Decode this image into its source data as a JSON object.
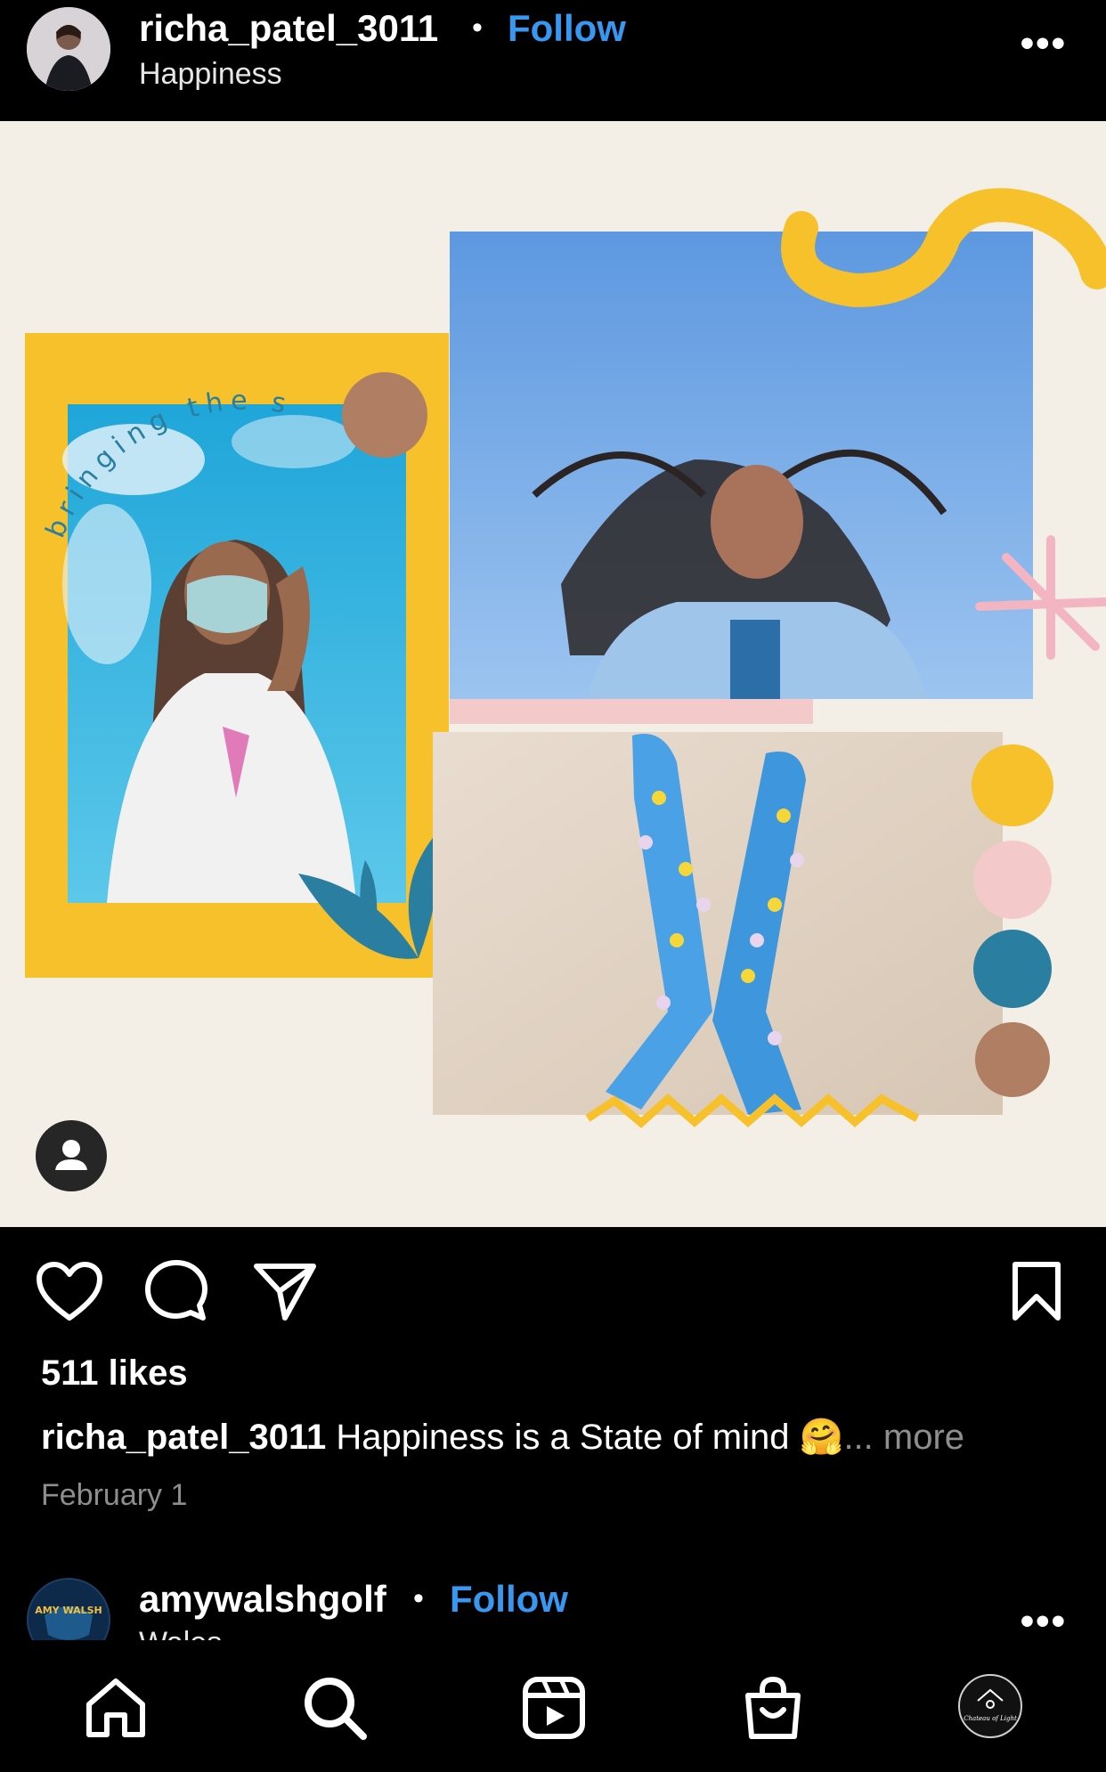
{
  "post": {
    "username": "richa_patel_3011",
    "separator": "•",
    "follow_label": "Follow",
    "subtitle": "Happiness",
    "more_label": "•••",
    "image": {
      "arc_text": "bringing the sunshine",
      "tag_people_icon": "person-icon"
    },
    "actions": {
      "like_icon": "heart-icon",
      "comment_icon": "comment-icon",
      "share_icon": "send-icon",
      "save_icon": "bookmark-icon"
    },
    "likes": "511 likes",
    "caption_user": "richa_patel_3011",
    "caption_text": " Happiness is a State of mind 🤗",
    "caption_more": "... more",
    "date": "February 1"
  },
  "next_post": {
    "username": "amywalshgolf",
    "separator": "•",
    "follow_label": "Follow",
    "subtitle": "Wales",
    "avatar_text": "AMY WALSH",
    "more_label": "•••"
  },
  "bottom_nav": {
    "items": [
      {
        "icon": "home-icon"
      },
      {
        "icon": "search-icon"
      },
      {
        "icon": "reels-icon"
      },
      {
        "icon": "shop-icon"
      },
      {
        "icon": "profile-avatar",
        "text": "Chateau of Light"
      }
    ]
  },
  "colors": {
    "accent": "#3897f0",
    "image_bg": "#f3eee6",
    "yellow": "#f6c12a",
    "teal": "#2a7fa0",
    "brown": "#b07e62",
    "pink": "#f4c9c9",
    "sky": "#78aeea"
  }
}
